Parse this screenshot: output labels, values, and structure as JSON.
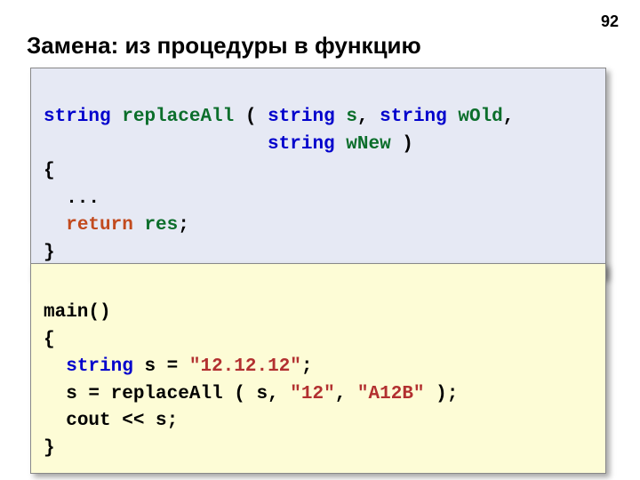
{
  "page_number": "92",
  "heading": "Замена: из процедуры в функцию",
  "code_top": {
    "l1": {
      "t1": "string",
      "fn": "replaceAll",
      "par_open": " ( ",
      "t2": "string",
      "a1": "s",
      "comma": ", ",
      "t3": "string",
      "a2": "wOld",
      "tail": ","
    },
    "l2": {
      "indent": "                    ",
      "t4": "string",
      "a3": "wNew",
      "close": " )"
    },
    "l3": "{",
    "l4": "  ...",
    "l5": {
      "indent": "  ",
      "ret": "return",
      "sp": " ",
      "res": "res",
      "semi": ";"
    },
    "l6": "}"
  },
  "code_bottom": {
    "l1": "main()",
    "l2": "{",
    "l3": {
      "indent": "  ",
      "t1": "string",
      "sp": " ",
      "var": "s",
      "eq": " = ",
      "lit": "\"12.12.12\"",
      "semi": ";"
    },
    "l4": {
      "indent": "  ",
      "lhs": "s = replaceAll ( s, ",
      "lit1": "\"12\"",
      "mid": ", ",
      "lit2": "\"A12B\"",
      "tail": " );"
    },
    "l5": {
      "indent": "  ",
      "cout": "cout << s;"
    },
    "l6": "}"
  }
}
